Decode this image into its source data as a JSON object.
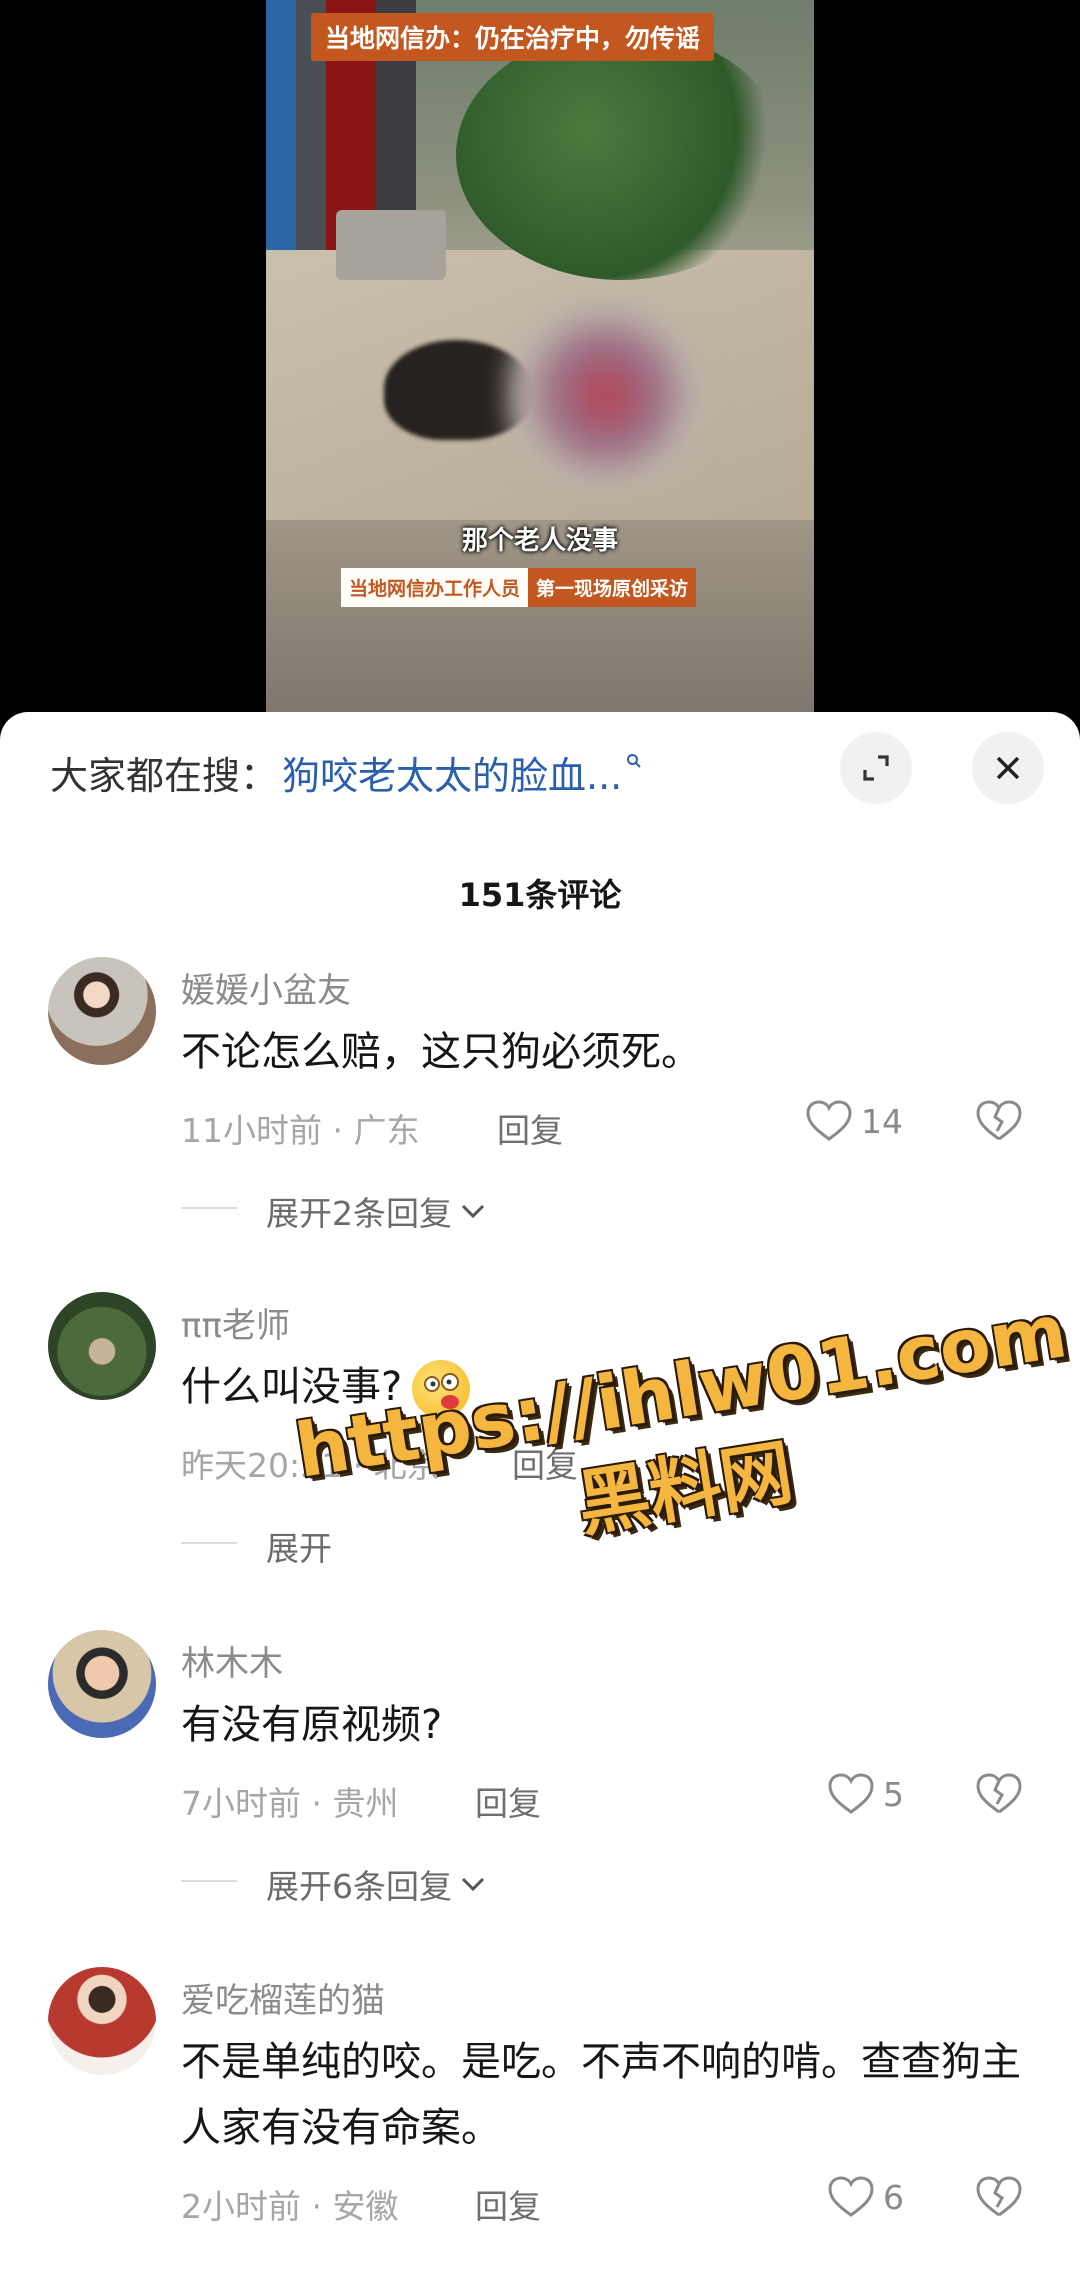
{
  "video": {
    "banner_top": "当地网信办：仍在治疗中，勿传谣",
    "subtitle": "那个老人没事",
    "tag_left": "当地网信办工作人员",
    "tag_right": "第一现场原创采访"
  },
  "search": {
    "prefix": "大家都在搜：",
    "term": "狗咬老太太的脸血..."
  },
  "comment_count": "151条评论",
  "comments": [
    {
      "user": "媛媛小盆友",
      "text": "不论怎么赔，这只狗必须死。",
      "time": "11小时前 · 广东",
      "reply": "回复",
      "likes": "14",
      "expand": "展开2条回复"
    },
    {
      "user": "ππ老师",
      "text": "什么叫没事?",
      "time": "昨天20:51 · 北京",
      "reply": "回复",
      "expand": "展开"
    },
    {
      "user": "林木木",
      "text": "有没有原视频?",
      "time": "7小时前 · 贵州",
      "reply": "回复",
      "likes": "5",
      "expand": "展开6条回复"
    },
    {
      "user": "爱吃榴莲的猫",
      "text": "不是单纯的咬。是吃。不声不响的啃。查查狗主人家有没有命案。",
      "time": "2小时前 · 安徽",
      "reply": "回复",
      "likes": "6"
    }
  ],
  "watermark": {
    "line1": "https://ihlw01.com",
    "line2": "黑料网"
  },
  "colors": {
    "link": "#2a5fae",
    "banner": "#c2571f",
    "watermark": "#f4b63f"
  }
}
